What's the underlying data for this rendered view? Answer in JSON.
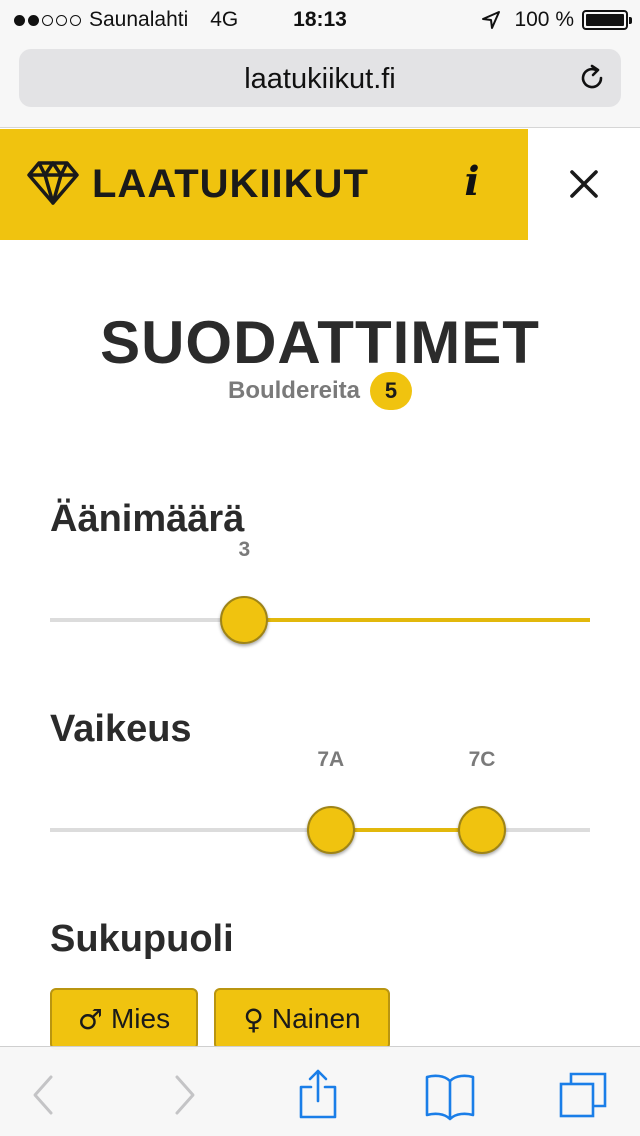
{
  "status_bar": {
    "carrier": "Saunalahti",
    "network": "4G",
    "time": "18:13",
    "battery": "100 %",
    "signal_strength": 2,
    "signal_max": 5
  },
  "browser": {
    "url": "laatukiikut.fi"
  },
  "header": {
    "logo_text": "LAATUKIIKUT",
    "info_label": "i"
  },
  "filters": {
    "title": "SUODATTIMET",
    "subtitle_label": "Bouldereita",
    "result_count": "5",
    "volume": {
      "heading": "Äänimäärä",
      "value_label": "3",
      "value_fraction": 0.36
    },
    "difficulty": {
      "heading": "Vaikeus",
      "min_label": "7A",
      "max_label": "7C",
      "min_fraction": 0.52,
      "max_fraction": 0.8
    },
    "gender": {
      "heading": "Sukupuoli",
      "options": [
        {
          "symbol": "♂",
          "label": "Mies"
        },
        {
          "symbol": "♀",
          "label": "Nainen"
        }
      ]
    }
  },
  "colors": {
    "accent": "#f0c30f",
    "text_dark": "#2b2b2b",
    "text_muted": "#7a7a7a",
    "ios_blue": "#1a7ee8"
  }
}
